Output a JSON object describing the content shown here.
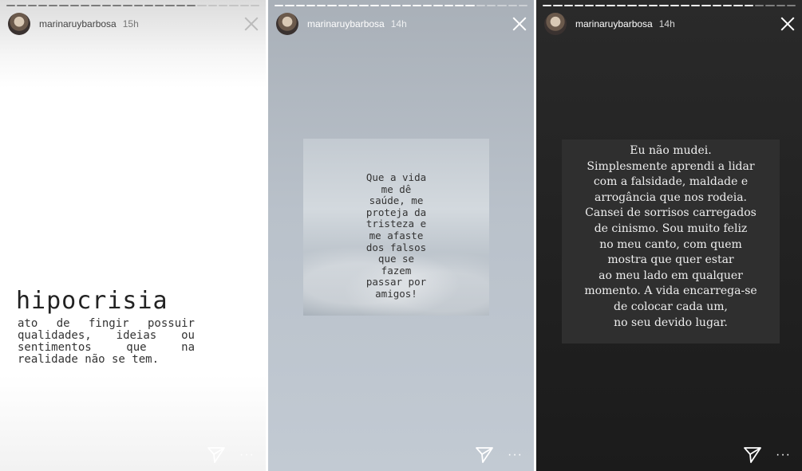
{
  "stories": [
    {
      "username": "marinaruybarbosa",
      "time": "15h",
      "title": "hipocrisia",
      "definition": "ato de fingir possuir qualidades, ideias ou sentimentos que na realidade não se tem."
    },
    {
      "username": "marinaruybarbosa",
      "time": "14h",
      "lines": [
        "Que a vida",
        "me dê",
        "saúde, me",
        "proteja da",
        "tristeza e",
        "me afaste",
        "dos falsos",
        "que se",
        "fazem",
        "passar por",
        "amigos!"
      ]
    },
    {
      "username": "marinaruybarbosa",
      "time": "14h",
      "lines": [
        "Eu não mudei.",
        "Simplesmente aprendi a lidar",
        "com a falsidade, maldade e",
        "arrogância que nos rodeia.",
        "Cansei de sorrisos carregados",
        "de cinismo. Sou muito feliz",
        "no meu canto, com quem",
        "mostra que quer estar",
        "ao meu lado em qualquer",
        "momento. A vida encarrega-se",
        "de colocar cada um,",
        "no seu devido lugar."
      ]
    }
  ],
  "footer": {
    "more_label": "···"
  },
  "icons": {
    "close": "close-icon",
    "send": "send-icon",
    "more": "more-icon"
  },
  "colors": {
    "dark_panel": "#222222",
    "sky_panel": "#b9c1ca"
  }
}
